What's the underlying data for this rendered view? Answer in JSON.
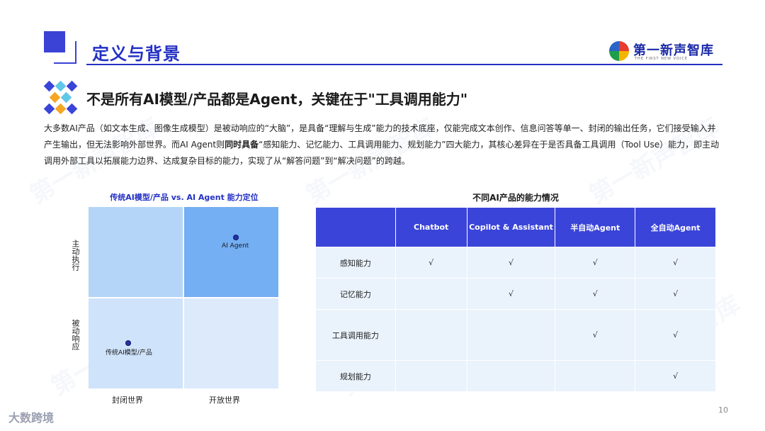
{
  "header": {
    "title": "定义与背景",
    "logo_text": "第一新声智库",
    "logo_sub": "THE FIRST NEW VOICE"
  },
  "subtitle": "不是所有AI模型/产品都是Agent，关键在于\"工具调用能力\"",
  "paragraph": {
    "part1": "大多数AI产品（如文本生成、图像生成模型）是被动响应的“大脑”，是具备“理解与生成”能力的技术底座，仅能完成文本创作、信息问答等单一、封闭的输出任务，它们接受输入并产生输出，但无法影响外部世界。而AI Agent则",
    "bold": "同时具备",
    "part2": "“感知能力、记忆能力、工具调用能力、规划能力”四大能力，其核心差异在于是否具备工具调用（Tool Use）能力，即主动调用外部工具以拓展能力边界、达成复杂目标的能力，实现了从“解答问题”到“解决问题”的跨越。"
  },
  "quadrant": {
    "title": "传统AI模型/产品 vs. AI Agent 能力定位",
    "y_top": "主动执行",
    "y_bottom": "被动响应",
    "x_left": "封闭世界",
    "x_right": "开放世界",
    "points": [
      {
        "label": "AI Agent",
        "quadrant": "开放世界 / 主动执行"
      },
      {
        "label": "传统AI模型/产品",
        "quadrant": "封闭世界 / 被动响应"
      }
    ]
  },
  "table": {
    "title": "不同AI产品的能力情况",
    "columns": [
      "",
      "Chatbot",
      "Copilot & Assistant",
      "半自动Agent",
      "全自动Agent"
    ],
    "rows": [
      {
        "label": "感知能力",
        "cells": [
          "√",
          "√",
          "√",
          "√"
        ]
      },
      {
        "label": "记忆能力",
        "cells": [
          "",
          "√",
          "√",
          "√"
        ]
      },
      {
        "label": "工具调用能力",
        "cells": [
          "",
          "",
          "√",
          "√"
        ]
      },
      {
        "label": "规划能力",
        "cells": [
          "",
          "",
          "",
          "√"
        ]
      }
    ]
  },
  "footer": {
    "page_number": "10",
    "brand": "大数跨境"
  },
  "watermark": "第一新声智库",
  "colors": {
    "accent": "#2330c4",
    "table_header": "#3a44d8",
    "table_cell": "#eaf3fc"
  }
}
